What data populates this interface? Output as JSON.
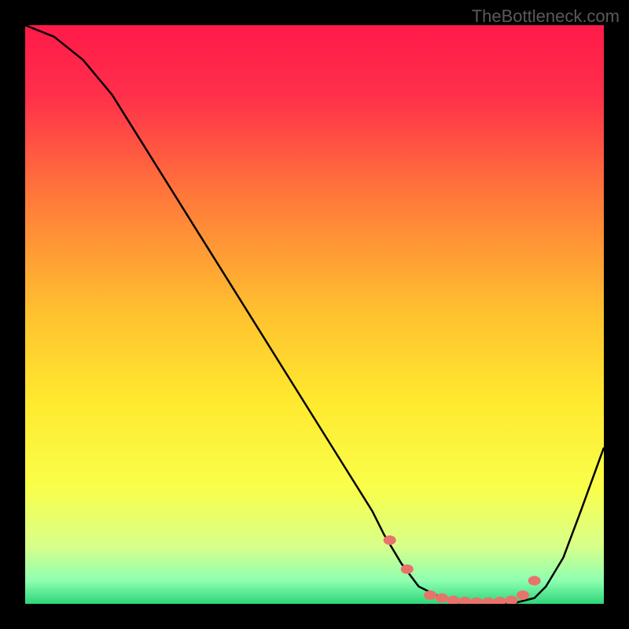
{
  "watermark": "TheBottleneck.com",
  "chart_data": {
    "type": "line",
    "title": "",
    "xlabel": "",
    "ylabel": "",
    "xlim": [
      0,
      100
    ],
    "ylim": [
      0,
      100
    ],
    "background_gradient": {
      "stops": [
        {
          "offset": 0,
          "color": "#ff1a4a"
        },
        {
          "offset": 0.12,
          "color": "#ff2f4a"
        },
        {
          "offset": 0.3,
          "color": "#ff7a3a"
        },
        {
          "offset": 0.5,
          "color": "#ffc22f"
        },
        {
          "offset": 0.65,
          "color": "#ffe92f"
        },
        {
          "offset": 0.8,
          "color": "#f9ff4a"
        },
        {
          "offset": 0.9,
          "color": "#d8ff8a"
        },
        {
          "offset": 0.96,
          "color": "#8effb0"
        },
        {
          "offset": 1.0,
          "color": "#2dd67a"
        }
      ]
    },
    "series": [
      {
        "name": "bottleneck-curve",
        "color": "#000000",
        "x": [
          0,
          5,
          10,
          15,
          20,
          25,
          30,
          35,
          40,
          45,
          50,
          55,
          60,
          62,
          65,
          68,
          72,
          76,
          80,
          84,
          88,
          90,
          93,
          96,
          100
        ],
        "y": [
          100,
          98,
          94,
          88,
          80,
          72,
          64,
          56,
          48,
          40,
          32,
          24,
          16,
          12,
          7,
          3,
          1,
          0,
          0,
          0,
          1,
          3,
          8,
          16,
          27
        ]
      }
    ],
    "markers": {
      "name": "highlight-region",
      "color": "#e8736b",
      "points": [
        {
          "x": 63,
          "y": 11
        },
        {
          "x": 66,
          "y": 6
        },
        {
          "x": 70,
          "y": 1.5
        },
        {
          "x": 72,
          "y": 1
        },
        {
          "x": 74,
          "y": 0.6
        },
        {
          "x": 76,
          "y": 0.4
        },
        {
          "x": 78,
          "y": 0.3
        },
        {
          "x": 80,
          "y": 0.3
        },
        {
          "x": 82,
          "y": 0.4
        },
        {
          "x": 84,
          "y": 0.6
        },
        {
          "x": 86,
          "y": 1.5
        },
        {
          "x": 88,
          "y": 4
        }
      ]
    }
  }
}
